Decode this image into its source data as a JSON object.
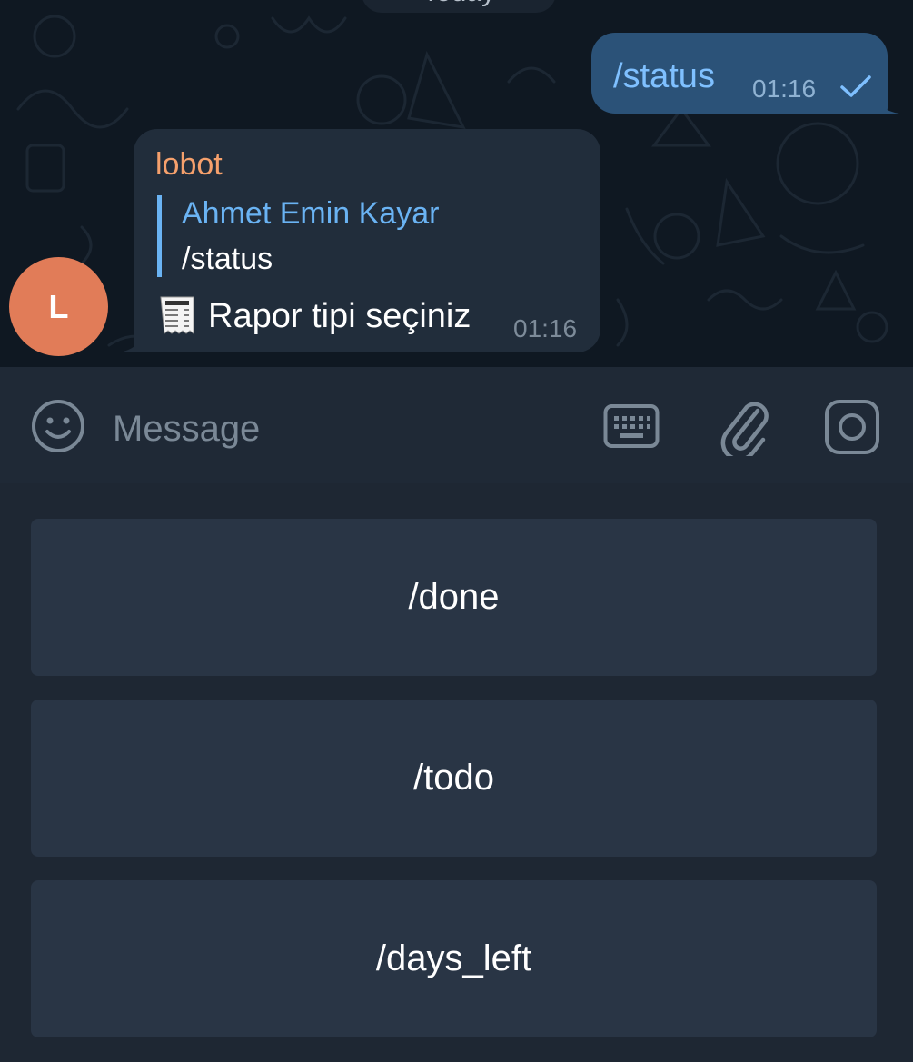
{
  "chat": {
    "date_label": "Today",
    "outgoing": {
      "text": "/status",
      "time": "01:16",
      "status": "read-check"
    },
    "incoming": {
      "sender": "lobot",
      "reply_to": {
        "name": "Ahmet Emin Kayar",
        "text": "/status"
      },
      "icon": "receipt-icon",
      "text": "Rapor tipi seçiniz",
      "time": "01:16"
    },
    "avatar_letter": "L"
  },
  "input_bar": {
    "placeholder": "Message",
    "icons": [
      "smile-icon",
      "keyboard-icon",
      "paperclip-icon",
      "camera-icon"
    ]
  },
  "bot_keyboard": {
    "buttons": [
      "/done",
      "/todo",
      "/days_left"
    ]
  },
  "colors": {
    "chat_bg": "#0f1822",
    "outgoing_bubble": "#2b5278",
    "incoming_bubble": "#212d3b",
    "sender_name": "#f5a06c",
    "reply_accent": "#6ab3f3",
    "avatar": "#e17c58",
    "keyboard_button": "#293545"
  }
}
